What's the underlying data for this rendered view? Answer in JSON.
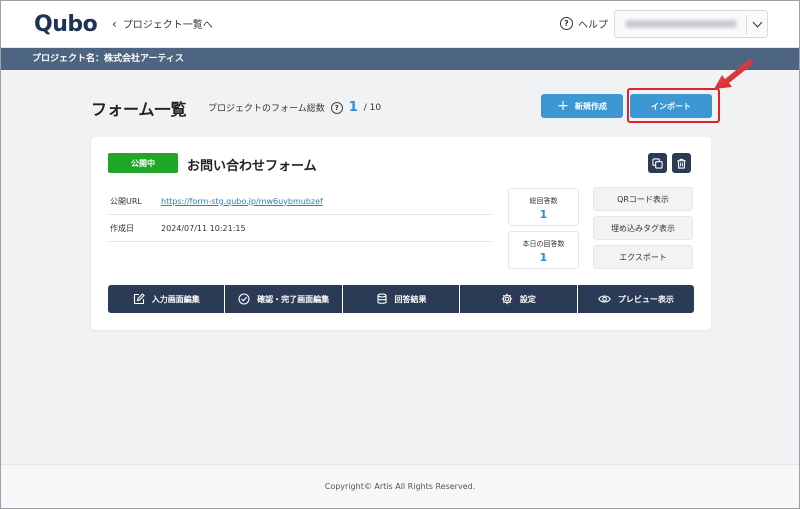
{
  "header": {
    "logo": "Qubo",
    "back_label": "プロジェクト一覧へ",
    "help_label": "ヘルプ",
    "user_select_value": ""
  },
  "project_bar": {
    "label": "プロジェクト名：株式会社アーティス"
  },
  "main": {
    "title": "フォーム一覧",
    "form_count_label": "プロジェクトのフォーム総数",
    "form_count_current": "1",
    "form_count_max": "/ 10",
    "new_button": "新規作成",
    "import_button": "インポート"
  },
  "form_card": {
    "status": "公開中",
    "title": "お問い合わせフォーム",
    "info": [
      {
        "label": "公開URL",
        "value": "https://form-stg.qubo.jp/mw6uybmubzef"
      },
      {
        "label": "作成日",
        "value": "2024/07/11 10:21:15"
      }
    ],
    "stats": [
      {
        "label": "総回答数",
        "value": "1"
      },
      {
        "label": "本日の回答数",
        "value": "1"
      }
    ],
    "side_buttons": [
      "QRコード表示",
      "埋め込みタグ表示",
      "エクスポート"
    ],
    "actions": [
      {
        "label": "入力画面編集",
        "icon": "edit-icon"
      },
      {
        "label": "確認・完了画面編集",
        "icon": "check-circle-icon"
      },
      {
        "label": "回答結果",
        "icon": "database-icon"
      },
      {
        "label": "設定",
        "icon": "gear-icon"
      },
      {
        "label": "プレビュー表示",
        "icon": "eye-icon"
      }
    ]
  },
  "footer": {
    "copyright": "Copyright© Artis All Rights Reserved."
  },
  "colors": {
    "navy": "#2b3b56",
    "accent_blue": "#3c97d3",
    "status_green": "#21a628",
    "highlight_red": "#e0222a",
    "project_bar": "#4d6581"
  }
}
